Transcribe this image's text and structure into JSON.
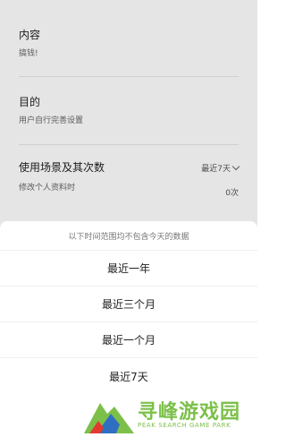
{
  "sections": {
    "content": {
      "title": "内容",
      "value": "搞钱!"
    },
    "purpose": {
      "title": "目的",
      "value": "用户自行完善设置"
    },
    "usage": {
      "title": "使用场景及其次数",
      "period": "最近7天",
      "scene": "修改个人资料时",
      "count": "0次"
    }
  },
  "sheet": {
    "notice": "以下时间范围均不包含今天的数据",
    "options": [
      "最近一年",
      "最近三个月",
      "最近一个月",
      "最近7天"
    ]
  },
  "watermark": {
    "title": "寻峰游戏园",
    "subtitle": "PEAK SEARCH GAME PARK",
    "colors": {
      "green": "#7cc04a",
      "blue": "#2f6fc2",
      "red": "#e23b2e"
    }
  }
}
